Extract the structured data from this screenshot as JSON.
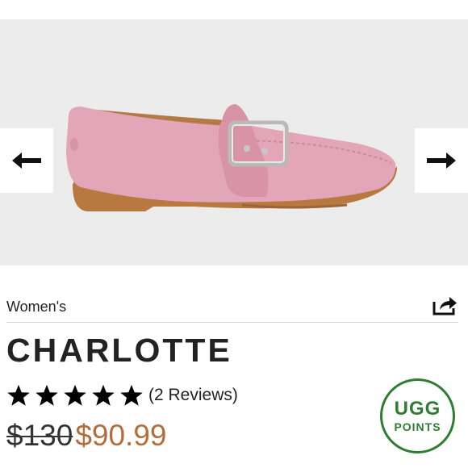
{
  "top_text_partial": "",
  "product": {
    "category": "Women's",
    "name": "CHARLOTTE",
    "rating": 5,
    "reviews_label": "(2 Reviews)",
    "original_price": "$130",
    "sale_price": "$90.99"
  },
  "rewards_badge": {
    "line1": "UGG",
    "line2": "POINTS"
  },
  "bottom_text_partial": {
    "text": "",
    "brand": ""
  },
  "colors": {
    "accent_price": "#b36f3b",
    "points_green": "#2e7d32",
    "shoe_pink": "#e3a5b8",
    "sole_tan": "#b7793f"
  },
  "icons": {
    "prev": "arrow-left-icon",
    "next": "arrow-right-icon",
    "share": "share-icon",
    "star": "star-icon"
  }
}
